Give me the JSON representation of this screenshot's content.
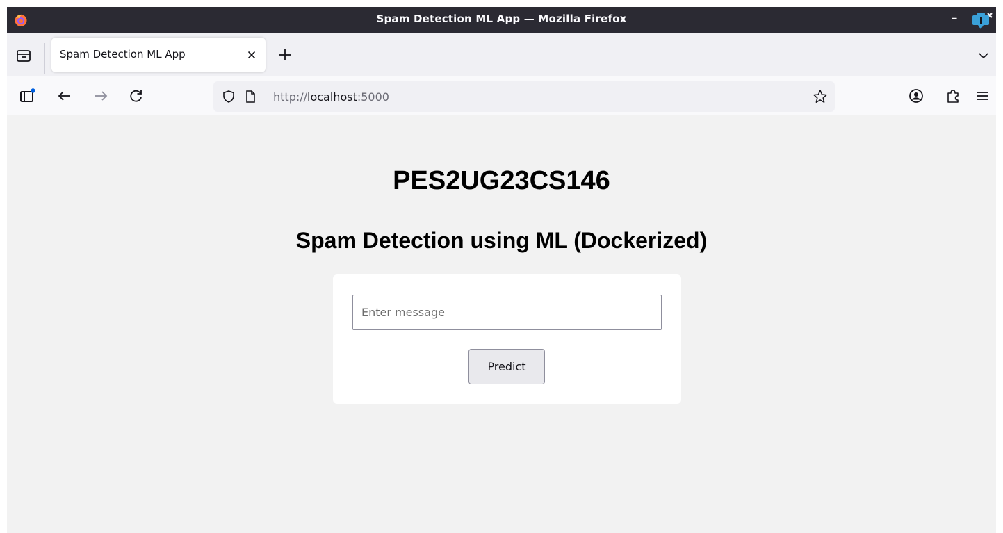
{
  "window": {
    "title": "Spam Detection ML App — Mozilla Firefox",
    "minimize_glyph": "–",
    "controls": [
      "firefox-logo",
      "minimize-icon",
      "close-icon"
    ]
  },
  "tabs": [
    {
      "label": "Spam Detection ML App",
      "active": true
    }
  ],
  "navbar": {
    "url_scheme": "http://",
    "url_host": "localhost",
    "url_port": ":5000",
    "icons": [
      "sidebar-icon",
      "back-arrow-icon",
      "forward-arrow-icon",
      "reload-icon",
      "shield-icon",
      "page-icon",
      "star-icon",
      "account-icon",
      "extensions-icon",
      "menu-icon"
    ]
  },
  "page": {
    "id_heading": "PES2UG23CS146",
    "subheading": "Spam Detection using ML (Dockerized)",
    "form": {
      "input_placeholder": "Enter message",
      "input_value": "",
      "submit_label": "Predict"
    }
  },
  "colors": {
    "titlebar": "#2b2a33",
    "tabstrip": "#f0f0f4",
    "navbar": "#f9f9fb",
    "page_background": "#f2f2f2",
    "card": "#ffffff",
    "button": "#e9e9ed",
    "accent": "#0060df"
  }
}
